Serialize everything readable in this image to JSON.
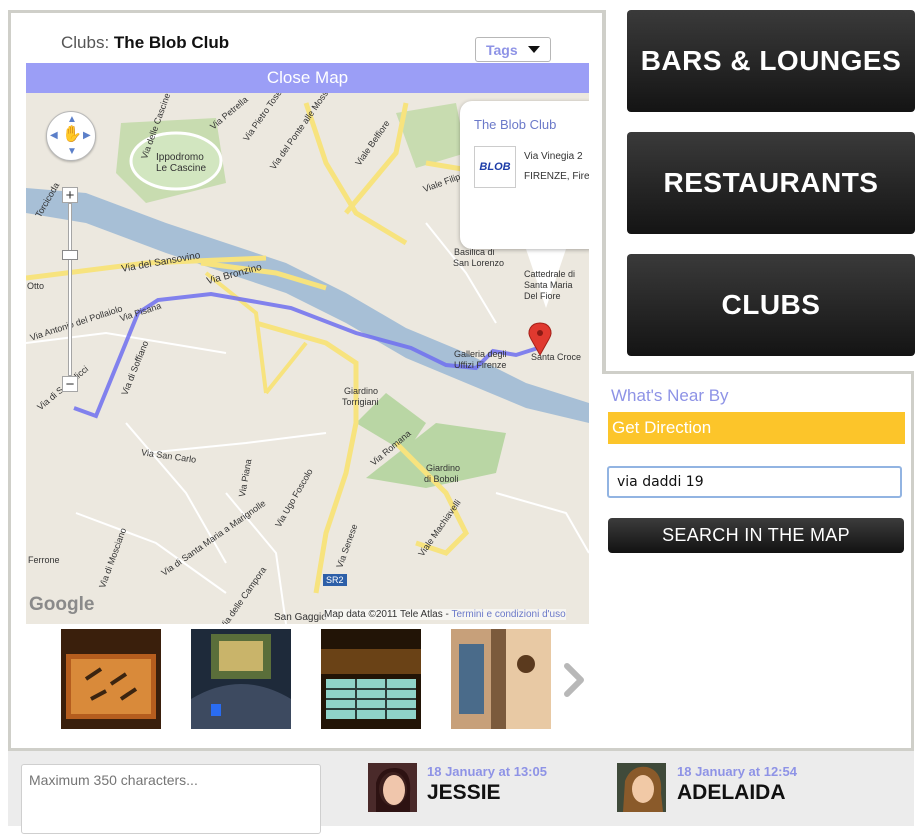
{
  "header": {
    "prefix": "Clubs:",
    "club_name": "The Blob Club",
    "tags_label": "Tags"
  },
  "map": {
    "close_label": "Close Map",
    "info": {
      "title": "The Blob Club",
      "logo_text": "BLOB",
      "address_line1": "Via Vinegia 2",
      "address_line2": "FIRENZE, Fire"
    },
    "google_logo": "Google",
    "credit": "Map data ©2011 Tele Atlas -",
    "terms": "Termini e condizioni d'uso",
    "labels": {
      "l1": "Via delle Cascine",
      "l2": "Ippodromo",
      "l3": "Le Cascine",
      "l4": "Via del Sansovino",
      "l5": "Via Bronzino",
      "l6": "Via Pisana",
      "l7": "Via Antonio del Pollaiolo",
      "l8": "Via di Soffiano",
      "l9": "Giardino",
      "l10": "Torrigiani",
      "l11": "Giardino",
      "l12": "di Boboli",
      "l13": "Galleria degli",
      "l14": "Uffizi Firenze",
      "l15": "Santa Croce",
      "l16": "Basilica di",
      "l17": "San Lorenzo",
      "l18": "Cattedrale di",
      "l19": "Santa Maria",
      "l20": "Viale Belfiore",
      "l21": "Via Romana",
      "l22": "Via San Carlo",
      "l23": "Via Senese",
      "l24": "Viale Machiavelli",
      "l25": "Via Ugo Foscolo",
      "l26": "Via di Santa Maria a Marignolle",
      "l27": "Via delle Campora",
      "l28": "Ferrone",
      "l29": "San Gaggio",
      "l30": "SR2",
      "l31": "Torcicoda",
      "l32": "Via del Ponte alle Mosse",
      "l33": "Via Pietro Toselli",
      "l34": "Via Petrella",
      "l35": "Via Piana",
      "l36": "Via di Scandicci",
      "l37": "Via di Mosciano",
      "l38": "Viale Filippo Strozzi",
      "l39": "Del Fiore",
      "l40": "Otto"
    }
  },
  "categories": [
    {
      "label": "BARS & LOUNGES"
    },
    {
      "label": "RESTAURANTS"
    },
    {
      "label": "CLUBS"
    }
  ],
  "sidebar": {
    "near_by": "What's Near By",
    "get_direction": "Get Direction",
    "address_value": "via daddi 19",
    "search_label": "SEARCH IN THE MAP"
  },
  "footer": {
    "comment_placeholder": "Maximum 350 characters...",
    "posts": [
      {
        "date": "18 January at 13:05",
        "user": "JESSIE"
      },
      {
        "date": "18 January at 12:54",
        "user": "ADELAIDA"
      }
    ]
  },
  "colors": {
    "accent": "#9b9ef6",
    "link": "#8e93e6",
    "direction": "#fcc52a",
    "route": "#6f6ff0"
  }
}
